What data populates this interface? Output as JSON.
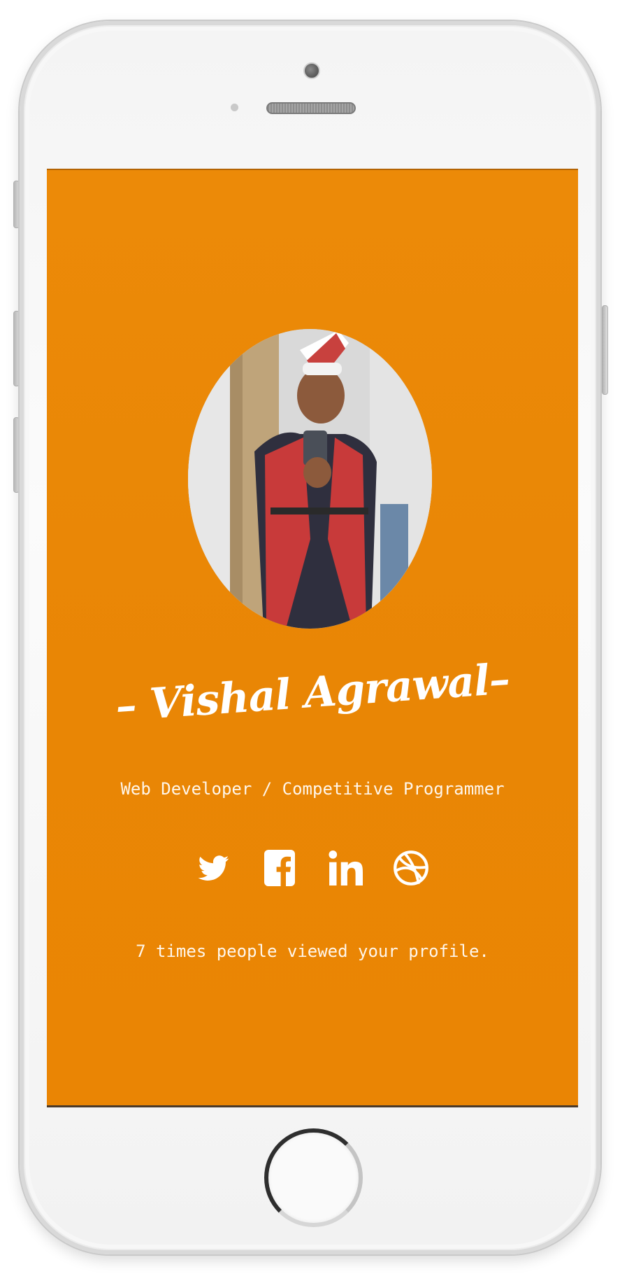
{
  "profile": {
    "name": "– Vishal Agrawal–",
    "title": "Web Developer / Competitive Programmer",
    "views_text": "7 times people viewed your profile."
  },
  "social_links": [
    {
      "icon": "twitter-icon"
    },
    {
      "icon": "facebook-icon"
    },
    {
      "icon": "linkedin-icon"
    },
    {
      "icon": "dribbble-icon"
    }
  ],
  "colors": {
    "screen_background": "#ea8605",
    "text": "#ffffff",
    "device_frame": "#f4f4f4"
  }
}
